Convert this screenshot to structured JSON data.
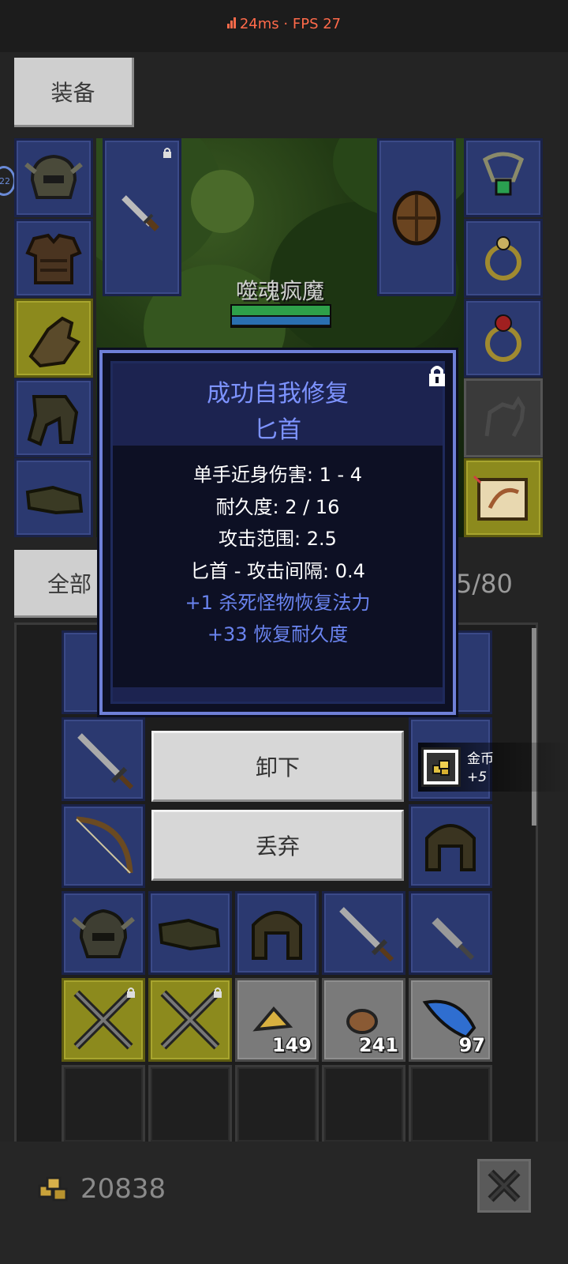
{
  "status": {
    "ping": "24ms",
    "fps": "FPS 27",
    "separator": "·"
  },
  "tabs": {
    "equipment": "装备",
    "all": "全部",
    "capacity": "5/80"
  },
  "preview": {
    "monster_name": "噬魂疯魔",
    "side_badge": "22"
  },
  "popup": {
    "title": "成功自我修复",
    "item_name": "匕首",
    "stats": [
      "单手近身伤害: 1 - 4",
      "耐久度: 2 / 16",
      "攻击范围: 2.5",
      "匕首 - 攻击间隔: 0.4"
    ],
    "bonuses": [
      "+1 杀死怪物恢复法力",
      "+33 恢复耐久度"
    ]
  },
  "actions": {
    "unequip": "卸下",
    "drop": "丢弃"
  },
  "toast": {
    "label": "金币",
    "amount": "+5"
  },
  "inventory_counts": {
    "gold_pile": "149",
    "meat": "241",
    "feather": "97"
  },
  "gold_total": "20838",
  "colors": {
    "accent_blue": "#7d93ff",
    "slot_blue": "#2b3970",
    "slot_gold": "#8c8a1d",
    "status_red": "#ff6a4a"
  }
}
